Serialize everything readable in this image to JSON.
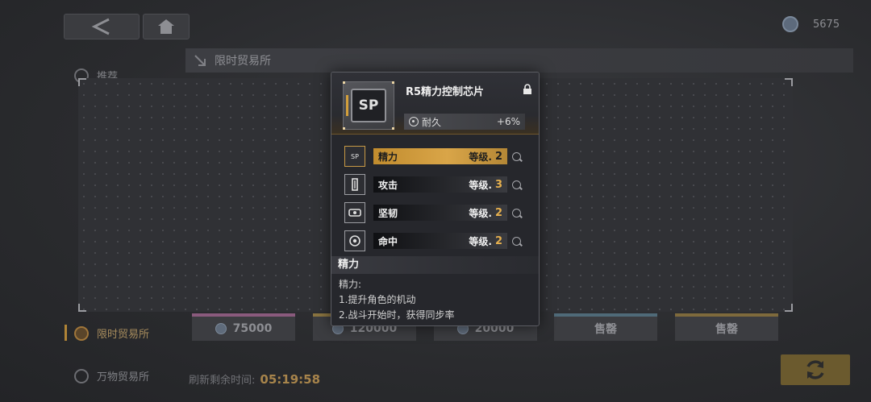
{
  "top_bar": {
    "back_icon": "back-arrow-icon",
    "home_icon": "home-icon",
    "currency_value": "5675"
  },
  "shop": {
    "header_title": "限时贸易所"
  },
  "sidebar": {
    "items": [
      {
        "label": "推荐"
      },
      {
        "label": "限时贸易所"
      },
      {
        "label": "万物贸易所"
      }
    ]
  },
  "prices": [
    {
      "value": "75000"
    },
    {
      "value": "120000"
    },
    {
      "value": "20000"
    },
    {
      "value": "售罄"
    },
    {
      "value": "售罄"
    }
  ],
  "refresh": {
    "label": "刷新剩余时间:",
    "time": "05:19:58"
  },
  "item_card": {
    "name": "R5精力控制芯片",
    "chip_label": "SP",
    "durability_label": "耐久",
    "durability_value": "+6%",
    "attributes": [
      {
        "icon_text": "SP",
        "name": "精力",
        "level_label": "等级.",
        "level": "2"
      },
      {
        "icon_text": "",
        "name": "攻击",
        "level_label": "等级.",
        "level": "3"
      },
      {
        "icon_text": "",
        "name": "坚韧",
        "level_label": "等级.",
        "level": "2"
      },
      {
        "icon_text": "",
        "name": "命中",
        "level_label": "等级.",
        "level": "2"
      }
    ],
    "description": {
      "title": "精力",
      "lines": [
        "精力:",
        "1.提升角色的机动",
        "2.战斗开始时，获得同步率"
      ]
    }
  },
  "colors": {
    "accent_gold": "#d9a548",
    "level_gold": "#e6b04e"
  }
}
